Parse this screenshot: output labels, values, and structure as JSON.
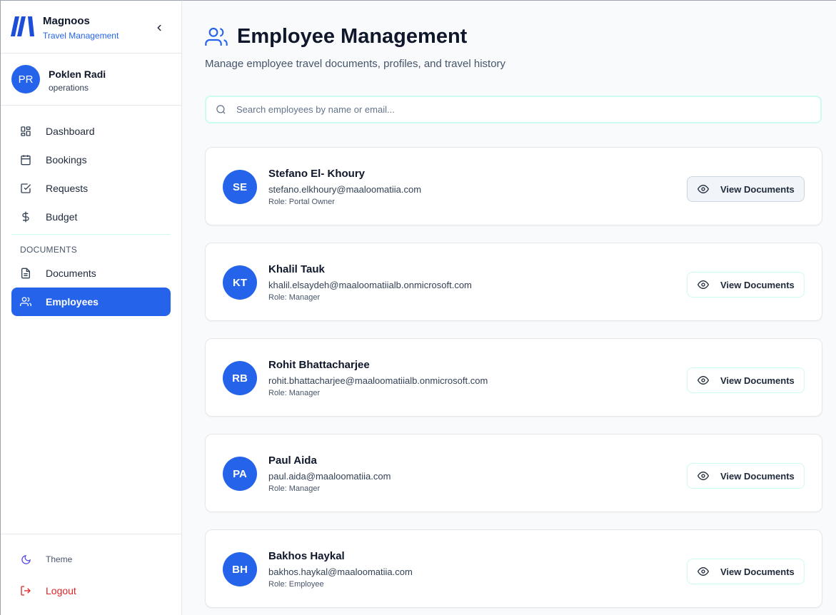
{
  "brand": {
    "name": "Magnoos",
    "subtitle": "Travel Management",
    "logo_icon": "magnoos-logo",
    "collapse_icon": "chevron-left-icon"
  },
  "user": {
    "initials": "PR",
    "name": "Poklen Radi",
    "role": "operations"
  },
  "nav": {
    "items": [
      {
        "label": "Dashboard",
        "icon": "grid-icon"
      },
      {
        "label": "Bookings",
        "icon": "calendar-icon"
      },
      {
        "label": "Requests",
        "icon": "check-square-icon"
      },
      {
        "label": "Budget",
        "icon": "dollar-icon"
      }
    ],
    "section_label": "DOCUMENTS",
    "doc_items": [
      {
        "label": "Documents",
        "icon": "file-text-icon"
      },
      {
        "label": "Employees",
        "icon": "users-icon",
        "active": true
      }
    ]
  },
  "footer": {
    "theme_label": "Theme",
    "logout_label": "Logout"
  },
  "page": {
    "title": "Employee Management",
    "subtitle": "Manage employee travel documents, profiles, and travel history",
    "title_icon": "users-icon"
  },
  "search": {
    "placeholder": "Search employees by name or email...",
    "value": ""
  },
  "employees": [
    {
      "initials": "SE",
      "name": "Stefano El- Khoury",
      "email": "stefano.elkhoury@maaloomatiia.com",
      "role": "Role: Portal Owner",
      "button": "View Documents"
    },
    {
      "initials": "KT",
      "name": "Khalil Tauk",
      "email": "khalil.elsaydeh@maaloomatiialb.onmicrosoft.com",
      "role": "Role: Manager",
      "button": "View Documents"
    },
    {
      "initials": "RB",
      "name": "Rohit Bhattacharjee",
      "email": "rohit.bhattacharjee@maaloomatiialb.onmicrosoft.com",
      "role": "Role: Manager",
      "button": "View Documents"
    },
    {
      "initials": "PA",
      "name": "Paul Aida",
      "email": "paul.aida@maaloomatiia.com",
      "role": "Role: Manager",
      "button": "View Documents"
    },
    {
      "initials": "BH",
      "name": "Bakhos Haykal",
      "email": "bakhos.haykal@maaloomatiia.com",
      "role": "Role: Employee",
      "button": "View Documents"
    }
  ],
  "colors": {
    "accent": "#2563eb",
    "danger": "#dc2626",
    "border_teal": "#ccfbf1"
  }
}
